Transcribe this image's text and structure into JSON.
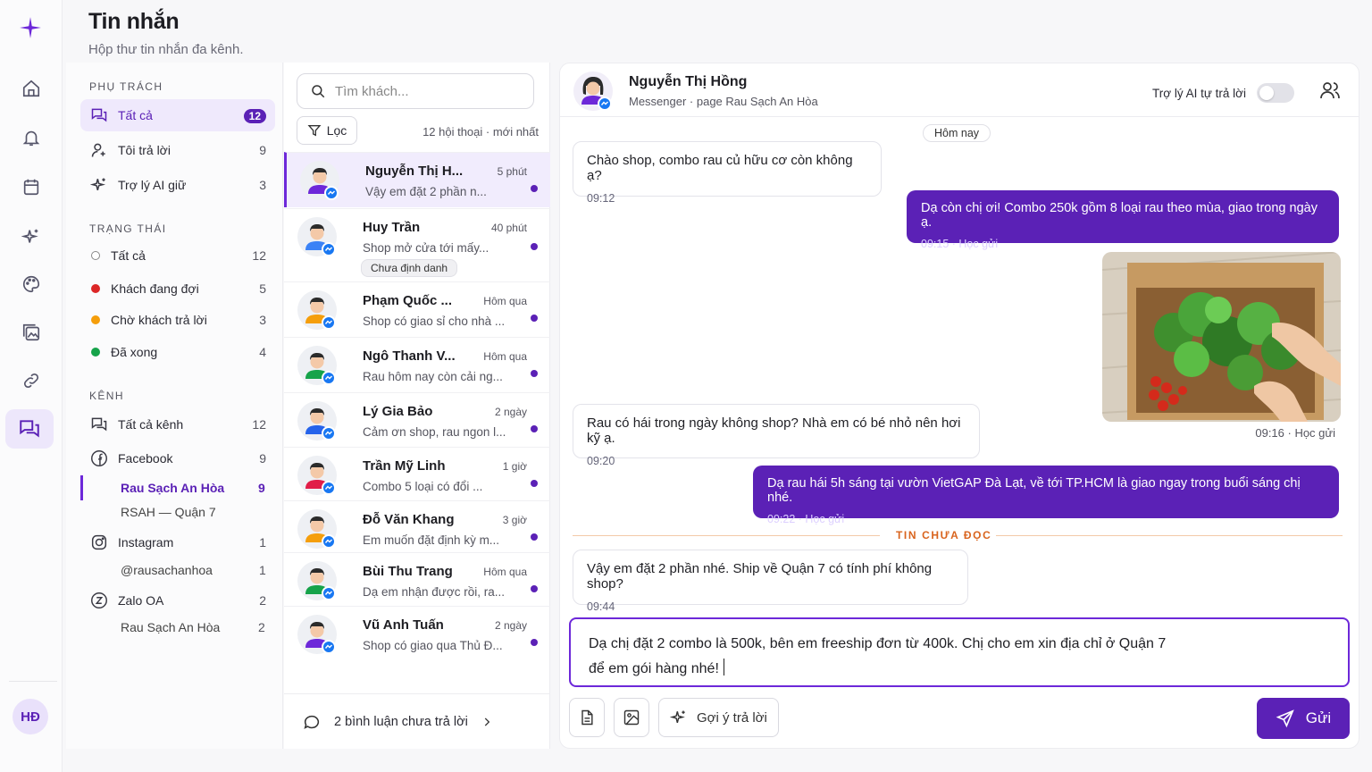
{
  "header": {
    "title": "Tin nhắn",
    "subtitle": "Hộp thư tin nhắn đa kênh."
  },
  "rail": {
    "avatar_initials": "HĐ",
    "active_color": "#5b21b6"
  },
  "filters": {
    "section_assign": "PHỤ TRÁCH",
    "assign": [
      {
        "label": "Tất cả",
        "count": "12",
        "icon": "chat-bubbles-icon"
      },
      {
        "label": "Tôi trả lời",
        "count": "9",
        "icon": "user-plus-icon"
      },
      {
        "label": "Trợ lý AI giữ",
        "count": "3",
        "icon": "sparkles-icon"
      }
    ],
    "section_status": "TRẠNG THÁI",
    "status": [
      {
        "label": "Tất cả",
        "count": "12",
        "color": "#ffffff"
      },
      {
        "label": "Khách đang đợi",
        "count": "5",
        "color": "#dc2626"
      },
      {
        "label": "Chờ khách trả lời",
        "count": "3",
        "color": "#f59e0b"
      },
      {
        "label": "Đã xong",
        "count": "4",
        "color": "#16a34a"
      }
    ],
    "section_channel": "KÊNH",
    "channels": {
      "all": {
        "label": "Tất cả kênh",
        "count": "12"
      },
      "facebook": {
        "label": "Facebook",
        "count": "9"
      },
      "fb_page1": {
        "label": "Rau Sạch An Hòa",
        "count": "9"
      },
      "fb_page2": {
        "label": "RSAH — Quận 7"
      },
      "instagram": {
        "label": "Instagram",
        "count": "1"
      },
      "ig_acc": {
        "label": "@rausachanhoa",
        "count": "1"
      },
      "zalo": {
        "label": "Zalo OA",
        "count": "2"
      },
      "zalo_acc": {
        "label": "Rau Sạch An Hòa",
        "count": "2"
      }
    }
  },
  "convlist": {
    "search_placeholder": "Tìm khách...",
    "filter_label": "Lọc",
    "meta": "12 hội thoại · mới nhất",
    "items": [
      {
        "name": "Nguyễn Thị H...",
        "time": "5 phút",
        "preview": "Vậy em đặt 2 phần n...",
        "shirt": "#6d28d9",
        "hair": "#2b2b2b"
      },
      {
        "name": "Huy Trần",
        "time": "40 phút",
        "preview": "Shop mở cửa tới mấy...",
        "tag": "Chưa định danh",
        "shirt": "#3b82f6",
        "hair": "#2b2b2b"
      },
      {
        "name": "Phạm Quốc ...",
        "time": "Hôm qua",
        "preview": "Shop có giao sỉ cho nhà ...",
        "shirt": "#f59e0b",
        "hair": "#2b2b2b"
      },
      {
        "name": "Ngô Thanh V...",
        "time": "Hôm qua",
        "preview": "Rau hôm nay còn cải ng...",
        "shirt": "#16a34a",
        "hair": "#2b2b2b"
      },
      {
        "name": "Lý Gia Bảo",
        "time": "2 ngày",
        "preview": "Cảm ơn shop, rau ngon l...",
        "shirt": "#2563eb",
        "hair": "#2b2b2b"
      },
      {
        "name": "Trần Mỹ Linh",
        "time": "1 giờ",
        "preview": "Combo 5 loại có đổi ...",
        "shirt": "#e11d48",
        "hair": "#2b2b2b"
      },
      {
        "name": "Đỗ Văn Khang",
        "time": "3 giờ",
        "preview": "Em muốn đặt định kỳ m...",
        "shirt": "#f59e0b",
        "hair": "#2b2b2b"
      },
      {
        "name": "Bùi Thu Trang",
        "time": "Hôm qua",
        "preview": "Dạ em nhận được rồi, ra...",
        "shirt": "#16a34a",
        "hair": "#2b2b2b"
      },
      {
        "name": "Vũ Anh Tuấn",
        "time": "2 ngày",
        "preview": "Shop có giao qua Thủ Đ...",
        "shirt": "#6d28d9",
        "hair": "#2b2b2b"
      }
    ],
    "comments_label": "2  bình luận chưa trả lời"
  },
  "chat": {
    "name": "Nguyễn Thị Hồng",
    "subtitle": "Messenger · page Rau Sạch An Hòa",
    "ai_label": "Trợ lý AI tự trả lời",
    "date_pill": "Hôm nay",
    "m1": {
      "text": "Chào shop, combo rau củ hữu cơ còn không ạ?",
      "time": "09:12"
    },
    "m2": {
      "text": "Dạ còn chị ơi! Combo 250k gồm 8 loại rau theo mùa, giao trong ngày ạ.",
      "time": "09:15 · Học gửi"
    },
    "photo_meta": "09:16 · Học gửi",
    "m3": {
      "text": "Rau có hái trong ngày không shop? Nhà em có bé nhỏ nên hơi kỹ ạ.",
      "time": "09:20"
    },
    "m4": {
      "text": "Dạ rau hái 5h sáng tại vườn VietGAP Đà Lạt, về tới TP.HCM là giao ngay trong buổi sáng chị nhé.",
      "time": "09:22 · Học gửi"
    },
    "unread_label": "TIN CHƯA ĐỌC",
    "m5": {
      "text": "Vậy em đặt 2 phần nhé. Ship về Quận 7 có tính phí không shop?",
      "time": "09:44"
    },
    "compose_line1": "Dạ chị đặt 2 combo là 500k, bên em freeship đơn từ 400k. Chị cho em xin địa chỉ ở Quận 7",
    "compose_line2": "để em gói hàng nhé!",
    "suggest_label": "Gợi ý trả lời",
    "send_label": "Gửi"
  }
}
